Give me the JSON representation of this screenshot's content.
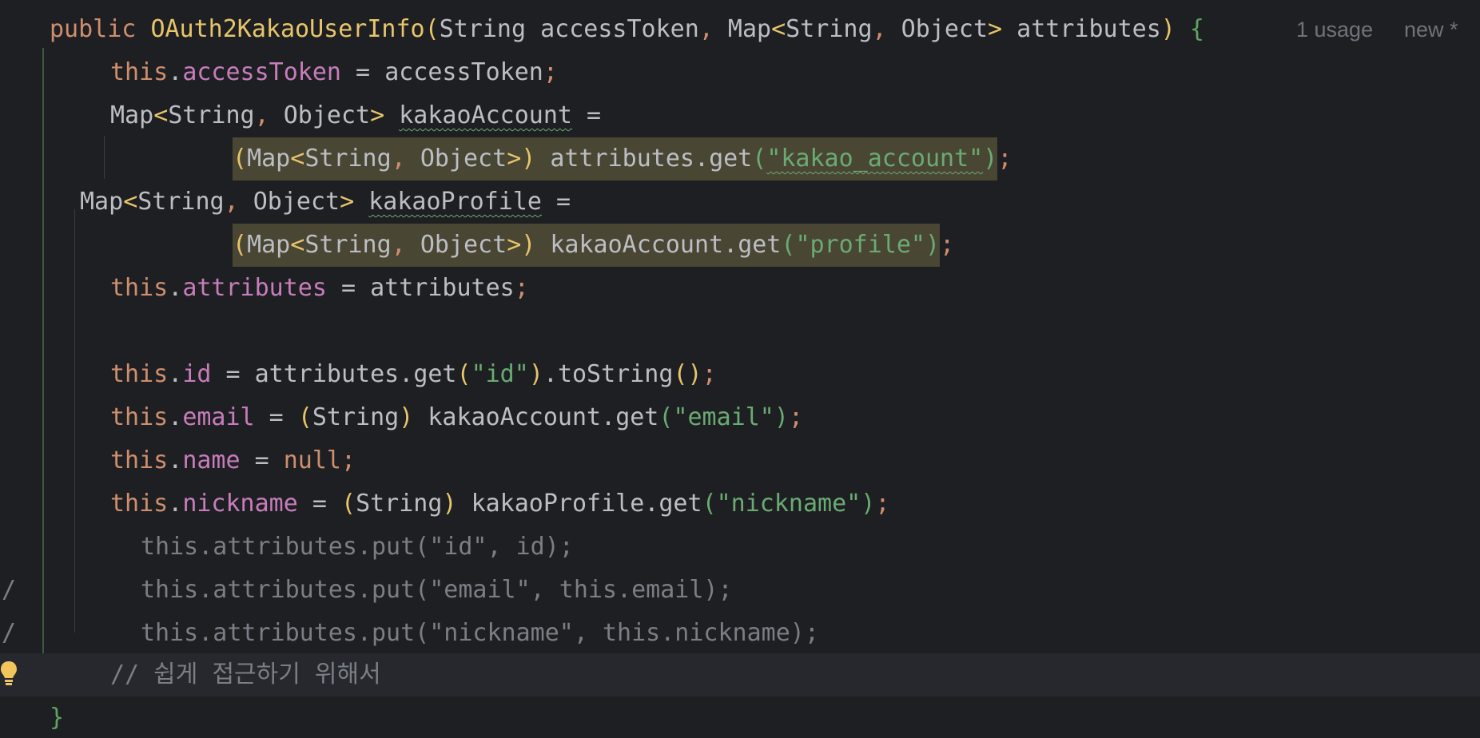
{
  "editor": {
    "inlay_usage": "1 usage",
    "inlay_new": "new *",
    "lines": [
      {
        "id": "l1"
      },
      {
        "id": "l2"
      }
    ],
    "tokens": {
      "public": "public",
      "ctor_name": "OAuth2KakaoUserInfo",
      "lparen": "(",
      "string_type": "String",
      "access_param": "accessToken",
      "comma": ",",
      "map": "Map",
      "lt": "<",
      "object": "Object",
      "gt": ">",
      "attrs_param": "attributes",
      "rparen": ")",
      "lbrace": "{",
      "rbrace": "}",
      "this": "this",
      "dot": ".",
      "access_field": "accessToken",
      "assign": " = ",
      "semi": ";",
      "kakao_account": "kakaoAccount",
      "kakao_profile": "kakaoProfile",
      "eq_tail": " =",
      "get": "get",
      "attributes": "attributes",
      "str_kakao_account": "\"kakao_account\"",
      "str_profile": "\"profile\"",
      "attributes_field": "attributes",
      "id_field": "id",
      "str_id": "\"id\"",
      "to_string": "toString",
      "unit_parens": "()",
      "email_field": "email",
      "str_email": "\"email\"",
      "name_field": "name",
      "null": "null",
      "nickname_field": "nickname",
      "str_nickname": "\"nickname\""
    },
    "commented_lines": [
      "this.attributes.put(\"id\", id);",
      "this.attributes.put(\"email\", this.email);",
      "this.attributes.put(\"nickname\", this.nickname);"
    ],
    "comment_prefix": "/",
    "current_comment": "// 쉽게 접근하기 위해서"
  },
  "colors": {
    "background": "#1e1f22",
    "keyword": "#cf8e6d",
    "method": "#e8c56b",
    "field": "#c77dbb",
    "string": "#6aab73",
    "text": "#bcbec4",
    "comment": "#7a7e85",
    "highlight": "#4a4634"
  }
}
